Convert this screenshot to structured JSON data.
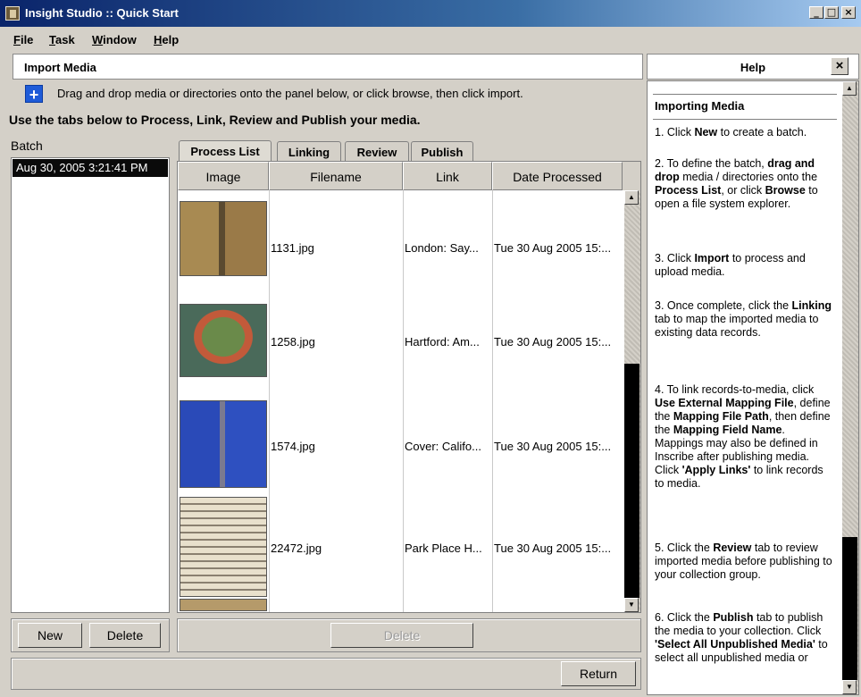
{
  "window": {
    "title": "Insight Studio :: Quick Start",
    "minimize_glyph": "_",
    "maximize_glyph": "□",
    "close_glyph": "×"
  },
  "menu": [
    "File",
    "Task",
    "Window",
    "Help"
  ],
  "import_panel": {
    "title": "Import Media",
    "plus_glyph": "+",
    "drop_hint": "Drag and drop media or directories onto the panel below, or click browse, then click import.",
    "instructions": "Use the tabs below to Process, Link, Review and Publish your media."
  },
  "batch": {
    "label": "Batch",
    "items": [
      "Aug 30, 2005 3:21:41 PM"
    ],
    "new_label": "New",
    "delete_label": "Delete"
  },
  "tabs": [
    {
      "label": "Process List",
      "active": true
    },
    {
      "label": "Linking",
      "active": false
    },
    {
      "label": "Review",
      "active": false
    },
    {
      "label": "Publish",
      "active": false
    }
  ],
  "table": {
    "columns": [
      "Image",
      "Filename",
      "Link",
      "Date Processed"
    ],
    "rows": [
      {
        "filename": "1131.jpg",
        "link": "London: Say...",
        "date": "Tue 30 Aug 2005 15:..."
      },
      {
        "filename": "1258.jpg",
        "link": "Hartford: Am...",
        "date": "Tue 30 Aug 2005 15:..."
      },
      {
        "filename": "1574.jpg",
        "link": "Cover: Califo...",
        "date": "Tue 30 Aug 2005 15:..."
      },
      {
        "filename": "22472.jpg",
        "link": "Park Place H...",
        "date": "Tue 30 Aug 2005 15:..."
      }
    ],
    "delete_label": "Delete"
  },
  "return_label": "Return",
  "help": {
    "title": "Help",
    "close_glyph": "×",
    "heading": "Importing Media",
    "steps": [
      "1. Click <b>New</b> to create a batch.",
      "2. To define the batch, <b>drag and drop</b> media / directories onto the <b>Process List</b>, or click <b>Browse</b> to open a file system explorer.",
      "3. Click <b>Import</b> to process and upload media.",
      "3. Once complete, click the <b>Linking</b> tab to map the imported media to existing data records.",
      "4. To link records-to-media, click <b>Use External Mapping File</b>, define the <b>Mapping File Path</b>, then define the <b>Mapping Field Name</b>. Mappings may also be defined in Inscribe after publishing media. Click <b>'Apply Links'</b> to link records to media.",
      "5. Click the <b>Review</b> tab to review imported media before publishing to your collection group.",
      "6. Click the <b>Publish</b> tab to publish the media to your collection. Click <b>'Select All Unpublished Media'</b> to select all unpublished media or"
    ]
  },
  "colors": {
    "titlebar_start": "#0a246a",
    "selection": "#0a0a0a",
    "plus_icon": "#1e5bd8"
  },
  "icons": {
    "app": "insight-studio-app-icon",
    "plus": "plus-icon",
    "scroll_up": "scroll-up-arrow-icon",
    "scroll_down": "scroll-down-arrow-icon"
  }
}
